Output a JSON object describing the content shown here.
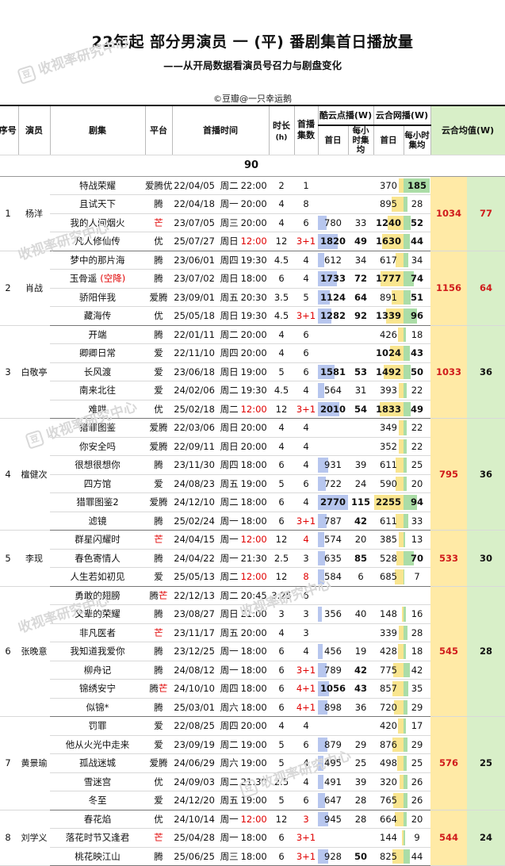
{
  "title": "22年起 部分男演员 一 (平) 番剧集首日播放量",
  "subtitle": "——从开局数据看演员号召力与剧盘变化",
  "credit": "©豆瓣@一只幸运鹅",
  "watermark": "收视率研究中心",
  "segment_label": "90",
  "headers": {
    "seq": "序号",
    "actor": "演员",
    "drama": "剧集",
    "platform": "平台",
    "airtime": "首播时间",
    "duration": "时长",
    "duration_unit": "(h)",
    "episodes": "首播集数",
    "ku_group": "酷云点播(W)",
    "yun_group": "云合网播(W)",
    "first_day": "首日",
    "hourly_avg": "每小时集均",
    "avg_group": "云合均值(W)"
  },
  "colors": {
    "red": "#e00000",
    "blue_bar": "#9fb3e8",
    "green_bar": "#8fd18a",
    "avg_bg": "#ffeaa6",
    "last_bg": "#d8efc8"
  },
  "groups": [
    {
      "seq": "1",
      "actor": "杨洋",
      "avg_day": "1034",
      "avg_hour": "77",
      "rows": [
        {
          "drama": "特战荣耀",
          "platform": "爱腾优",
          "date": "22/04/05",
          "weekday": "周二",
          "time": "22:00",
          "time_red": false,
          "dur": "2",
          "eps": "1",
          "eps_red": false,
          "ku_day": "",
          "ku_hour": "",
          "yun_day": "370",
          "yun_hour": "185",
          "yun_day_bold": false,
          "yun_hour_bold": true
        },
        {
          "drama": "且试天下",
          "platform": "腾",
          "date": "22/04/18",
          "weekday": "周一",
          "time": "20:00",
          "time_red": false,
          "dur": "4",
          "eps": "8",
          "eps_red": false,
          "ku_day": "",
          "ku_hour": "",
          "yun_day": "895",
          "yun_hour": "28"
        },
        {
          "drama": "我的人间烟火",
          "platform": "芒",
          "platform_red": true,
          "date": "23/07/05",
          "weekday": "周三",
          "time": "20:00",
          "time_red": false,
          "dur": "4",
          "eps": "6",
          "eps_red": false,
          "ku_day": "780",
          "ku_hour": "33",
          "yun_day": "1240",
          "yun_hour": "52",
          "yun_day_bold": true,
          "yun_hour_bold": true
        },
        {
          "drama": "凡人修仙传",
          "platform": "优",
          "date": "25/07/27",
          "weekday": "周日",
          "time": "12:00",
          "time_red": true,
          "dur": "12",
          "eps": "3+1",
          "eps_red": true,
          "ku_day": "1820",
          "ku_hour": "49",
          "ku_day_bold": true,
          "ku_hour_bold": true,
          "yun_day": "1630",
          "yun_hour": "44",
          "yun_day_bold": true,
          "yun_hour_bold": true
        }
      ]
    },
    {
      "seq": "2",
      "actor": "肖战",
      "avg_day": "1156",
      "avg_hour": "64",
      "rows": [
        {
          "drama": "梦中的那片海",
          "platform": "腾",
          "date": "23/06/01",
          "weekday": "周四",
          "time": "19:30",
          "dur": "4.5",
          "eps": "4",
          "ku_day": "612",
          "ku_hour": "34",
          "yun_day": "617",
          "yun_hour": "34"
        },
        {
          "drama": "玉骨遥",
          "drama_note": "(空降)",
          "platform": "腾",
          "date": "23/07/02",
          "weekday": "周日",
          "time": "18:00",
          "dur": "6",
          "eps": "4",
          "ku_day": "1733",
          "ku_hour": "72",
          "ku_day_bold": true,
          "ku_hour_bold": true,
          "yun_day": "1777",
          "yun_hour": "74",
          "yun_day_bold": true,
          "yun_hour_bold": true
        },
        {
          "drama": "骄阳伴我",
          "platform": "爱腾",
          "date": "23/09/01",
          "weekday": "周五",
          "time": "20:30",
          "dur": "3.5",
          "eps": "5",
          "ku_day": "1124",
          "ku_hour": "64",
          "ku_day_bold": true,
          "ku_hour_bold": true,
          "yun_day": "891",
          "yun_hour": "51",
          "yun_hour_bold": true
        },
        {
          "drama": "藏海传",
          "platform": "优",
          "date": "25/05/18",
          "weekday": "周日",
          "time": "19:30",
          "dur": "4.5",
          "eps": "3+1",
          "eps_red": true,
          "ku_day": "1282",
          "ku_hour": "92",
          "ku_day_bold": true,
          "ku_hour_bold": true,
          "yun_day": "1339",
          "yun_hour": "96",
          "yun_day_bold": true,
          "yun_hour_bold": true
        }
      ]
    },
    {
      "seq": "3",
      "actor": "白敬亭",
      "avg_day": "1033",
      "avg_hour": "36",
      "rows": [
        {
          "drama": "开端",
          "platform": "腾",
          "date": "22/01/11",
          "weekday": "周二",
          "time": "20:00",
          "dur": "4",
          "eps": "6",
          "ku_day": "",
          "ku_hour": "",
          "yun_day": "426",
          "yun_hour": "18"
        },
        {
          "drama": "卿卿日常",
          "platform": "爱",
          "date": "22/11/10",
          "weekday": "周四",
          "time": "20:00",
          "dur": "4",
          "eps": "6",
          "ku_day": "",
          "ku_hour": "",
          "yun_day": "1024",
          "yun_hour": "43",
          "yun_day_bold": true,
          "yun_hour_bold": true
        },
        {
          "drama": "长风渡",
          "platform": "爱",
          "date": "23/06/18",
          "weekday": "周日",
          "time": "19:00",
          "dur": "5",
          "eps": "6",
          "ku_day": "1581",
          "ku_hour": "53",
          "ku_day_bold": true,
          "ku_hour_bold": true,
          "yun_day": "1492",
          "yun_hour": "50",
          "yun_day_bold": true,
          "yun_hour_bold": true
        },
        {
          "drama": "南来北往",
          "platform": "爱",
          "date": "24/02/06",
          "weekday": "周二",
          "time": "19:30",
          "dur": "4.5",
          "eps": "4",
          "ku_day": "564",
          "ku_hour": "31",
          "yun_day": "393",
          "yun_hour": "22"
        },
        {
          "drama": "难哄",
          "platform": "优",
          "date": "25/02/18",
          "weekday": "周二",
          "time": "12:00",
          "time_red": true,
          "dur": "12",
          "eps": "3+1",
          "eps_red": true,
          "ku_day": "2010",
          "ku_hour": "54",
          "ku_day_bold": true,
          "ku_hour_bold": true,
          "yun_day": "1833",
          "yun_hour": "49",
          "yun_day_bold": true,
          "yun_hour_bold": true
        }
      ]
    },
    {
      "seq": "4",
      "actor": "檀健次",
      "avg_day": "795",
      "avg_hour": "36",
      "rows": [
        {
          "drama": "猎罪图鉴",
          "platform": "爱腾",
          "date": "22/03/06",
          "weekday": "周日",
          "time": "20:00",
          "dur": "4",
          "eps": "4",
          "ku_day": "",
          "ku_hour": "",
          "yun_day": "349",
          "yun_hour": "22"
        },
        {
          "drama": "你安全吗",
          "platform": "爱腾",
          "date": "22/09/11",
          "weekday": "周日",
          "time": "20:00",
          "dur": "4",
          "eps": "4",
          "ku_day": "",
          "ku_hour": "",
          "yun_day": "352",
          "yun_hour": "22"
        },
        {
          "drama": "很想很想你",
          "platform": "腾",
          "date": "23/11/30",
          "weekday": "周四",
          "time": "18:00",
          "dur": "6",
          "eps": "4",
          "ku_day": "931",
          "ku_hour": "39",
          "yun_day": "611",
          "yun_hour": "25"
        },
        {
          "drama": "四方馆",
          "platform": "爱",
          "date": "24/08/23",
          "weekday": "周五",
          "time": "19:00",
          "dur": "5",
          "eps": "6",
          "ku_day": "722",
          "ku_hour": "24",
          "yun_day": "590",
          "yun_hour": "20"
        },
        {
          "drama": "猎罪图鉴2",
          "platform": "爱腾",
          "date": "24/12/10",
          "weekday": "周二",
          "time": "18:00",
          "dur": "6",
          "eps": "4",
          "ku_day": "2770",
          "ku_hour": "115",
          "ku_day_bold": true,
          "ku_hour_bold": true,
          "yun_day": "2255",
          "yun_hour": "94",
          "yun_day_bold": true,
          "yun_hour_bold": true
        },
        {
          "drama": "滤镜",
          "platform": "腾",
          "date": "25/02/24",
          "weekday": "周一",
          "time": "18:00",
          "dur": "6",
          "eps": "3+1",
          "eps_red": true,
          "ku_day": "787",
          "ku_hour": "42",
          "ku_hour_bold": true,
          "yun_day": "611",
          "yun_hour": "33"
        }
      ]
    },
    {
      "seq": "5",
      "actor": "李现",
      "avg_day": "533",
      "avg_hour": "30",
      "rows": [
        {
          "drama": "群星闪耀时",
          "platform": "芒",
          "platform_red": true,
          "date": "24/04/15",
          "weekday": "周一",
          "time": "12:00",
          "time_red": true,
          "dur": "12",
          "eps": "4",
          "eps_red": true,
          "ku_day": "574",
          "ku_hour": "20",
          "yun_day": "385",
          "yun_hour": "13"
        },
        {
          "drama": "春色寄情人",
          "platform": "腾",
          "date": "24/04/22",
          "weekday": "周一",
          "time": "21:30",
          "dur": "2.5",
          "eps": "3",
          "ku_day": "635",
          "ku_hour": "85",
          "ku_hour_bold": true,
          "yun_day": "528",
          "yun_hour": "70",
          "yun_hour_bold": true
        },
        {
          "drama": "人生若如初见",
          "platform": "爱",
          "date": "25/05/13",
          "weekday": "周二",
          "time": "12:00",
          "time_red": true,
          "dur": "12",
          "eps": "8",
          "eps_red": true,
          "ku_day": "584",
          "ku_hour": "6",
          "yun_day": "685",
          "yun_hour": "7"
        }
      ]
    },
    {
      "seq": "6",
      "actor": "张晚意",
      "avg_day": "545",
      "avg_hour": "28",
      "rows": [
        {
          "drama": "勇敢的翅膀",
          "platform": "腾芒",
          "platform_red_part": "芒",
          "date": "22/12/13",
          "weekday": "周二",
          "time": "20:45",
          "dur": "3.25",
          "eps": "6",
          "ku_day": "",
          "ku_hour": "",
          "yun_day": "",
          "yun_hour": ""
        },
        {
          "drama": "父辈的荣耀",
          "platform": "腾",
          "date": "23/08/27",
          "weekday": "周日",
          "time": "21:00",
          "dur": "3",
          "eps": "3",
          "ku_day": "356",
          "ku_hour": "40",
          "yun_day": "148",
          "yun_hour": "16"
        },
        {
          "drama": "非凡医者",
          "platform": "芒",
          "platform_red": true,
          "date": "23/11/17",
          "weekday": "周五",
          "time": "20:00",
          "dur": "4",
          "eps": "3",
          "ku_day": "",
          "ku_hour": "",
          "yun_day": "339",
          "yun_hour": "28"
        },
        {
          "drama": "我知道我爱你",
          "platform": "腾",
          "date": "23/12/25",
          "weekday": "周一",
          "time": "18:00",
          "dur": "6",
          "eps": "4",
          "ku_day": "456",
          "ku_hour": "19",
          "yun_day": "428",
          "yun_hour": "18"
        },
        {
          "drama": "柳舟记",
          "platform": "腾",
          "date": "24/08/12",
          "weekday": "周一",
          "time": "18:00",
          "dur": "6",
          "eps": "3+1",
          "eps_red": true,
          "ku_day": "789",
          "ku_hour": "42",
          "ku_hour_bold": true,
          "yun_day": "775",
          "yun_hour": "42"
        },
        {
          "drama": "锦绣安宁",
          "platform": "腾芒",
          "platform_red_part": "芒",
          "date": "24/10/10",
          "weekday": "周四",
          "time": "18:00",
          "dur": "6",
          "eps": "4+1",
          "eps_red": true,
          "ku_day": "1056",
          "ku_hour": "43",
          "ku_day_bold": true,
          "ku_hour_bold": true,
          "yun_day": "857",
          "yun_hour": "35"
        },
        {
          "drama": "似锦*",
          "platform": "腾",
          "date": "25/03/01",
          "weekday": "周六",
          "time": "18:00",
          "dur": "6",
          "eps": "4+1",
          "eps_red": true,
          "ku_day": "898",
          "ku_hour": "36",
          "yun_day": "720",
          "yun_hour": "29"
        }
      ]
    },
    {
      "seq": "7",
      "actor": "黄景瑜",
      "avg_day": "576",
      "avg_hour": "25",
      "rows": [
        {
          "drama": "罚罪",
          "platform": "爱",
          "date": "22/08/25",
          "weekday": "周四",
          "time": "20:00",
          "dur": "4",
          "eps": "4",
          "ku_day": "",
          "ku_hour": "",
          "yun_day": "420",
          "yun_hour": "17"
        },
        {
          "drama": "他从火光中走来",
          "platform": "爱",
          "date": "23/09/19",
          "weekday": "周二",
          "time": "19:00",
          "dur": "5",
          "eps": "6",
          "ku_day": "879",
          "ku_hour": "29",
          "yun_day": "876",
          "yun_hour": "29"
        },
        {
          "drama": "孤战迷城",
          "platform": "爱腾",
          "date": "24/06/29",
          "weekday": "周六",
          "time": "19:00",
          "dur": "5",
          "eps": "4",
          "ku_day": "495",
          "ku_hour": "25",
          "yun_day": "498",
          "yun_hour": "25"
        },
        {
          "drama": "雪迷宫",
          "platform": "优",
          "date": "24/09/03",
          "weekday": "周二",
          "time": "21:30",
          "dur": "2.5",
          "eps": "4",
          "ku_day": "491",
          "ku_hour": "39",
          "yun_day": "320",
          "yun_hour": "26"
        },
        {
          "drama": "冬至",
          "platform": "爱",
          "date": "24/12/20",
          "weekday": "周五",
          "time": "19:00",
          "dur": "5",
          "eps": "6",
          "ku_day": "647",
          "ku_hour": "28",
          "yun_day": "765",
          "yun_hour": "26"
        }
      ]
    },
    {
      "seq": "8",
      "actor": "刘学义",
      "avg_day": "544",
      "avg_hour": "24",
      "rows": [
        {
          "drama": "春花焰",
          "platform": "优",
          "date": "24/10/14",
          "weekday": "周一",
          "time": "12:00",
          "time_red": true,
          "dur": "12",
          "eps": "3",
          "eps_red": true,
          "ku_day": "945",
          "ku_hour": "28",
          "yun_day": "664",
          "yun_hour": "20"
        },
        {
          "drama": "落花时节又逢君",
          "platform": "芒",
          "platform_red": true,
          "date": "25/04/28",
          "weekday": "周一",
          "time": "18:00",
          "dur": "6",
          "eps": "3+1",
          "eps_red": true,
          "ku_day": "",
          "ku_hour": "",
          "yun_day": "144",
          "yun_hour": "9"
        },
        {
          "drama": "桃花映江山",
          "platform": "腾",
          "date": "25/06/25",
          "weekday": "周三",
          "time": "18:00",
          "dur": "6",
          "eps": "3+1",
          "eps_red": true,
          "ku_day": "928",
          "ku_hour": "50",
          "ku_hour_bold": true,
          "yun_day": "825",
          "yun_hour": "44"
        }
      ]
    }
  ],
  "chart_data": {
    "type": "table",
    "title": "22年起 部分男演员 一 (平) 番剧集首日播放量",
    "subtitle": "——从开局数据看演员号召力与剧盘变化",
    "columns": [
      "序号",
      "演员",
      "剧集",
      "平台",
      "首播时间",
      "时长(h)",
      "首播集数",
      "酷云点播首日(W)",
      "酷云点播每小时集均",
      "云合网播首日(W)",
      "云合网播每小时集均",
      "云合均值首日",
      "云合均值每小时"
    ]
  }
}
